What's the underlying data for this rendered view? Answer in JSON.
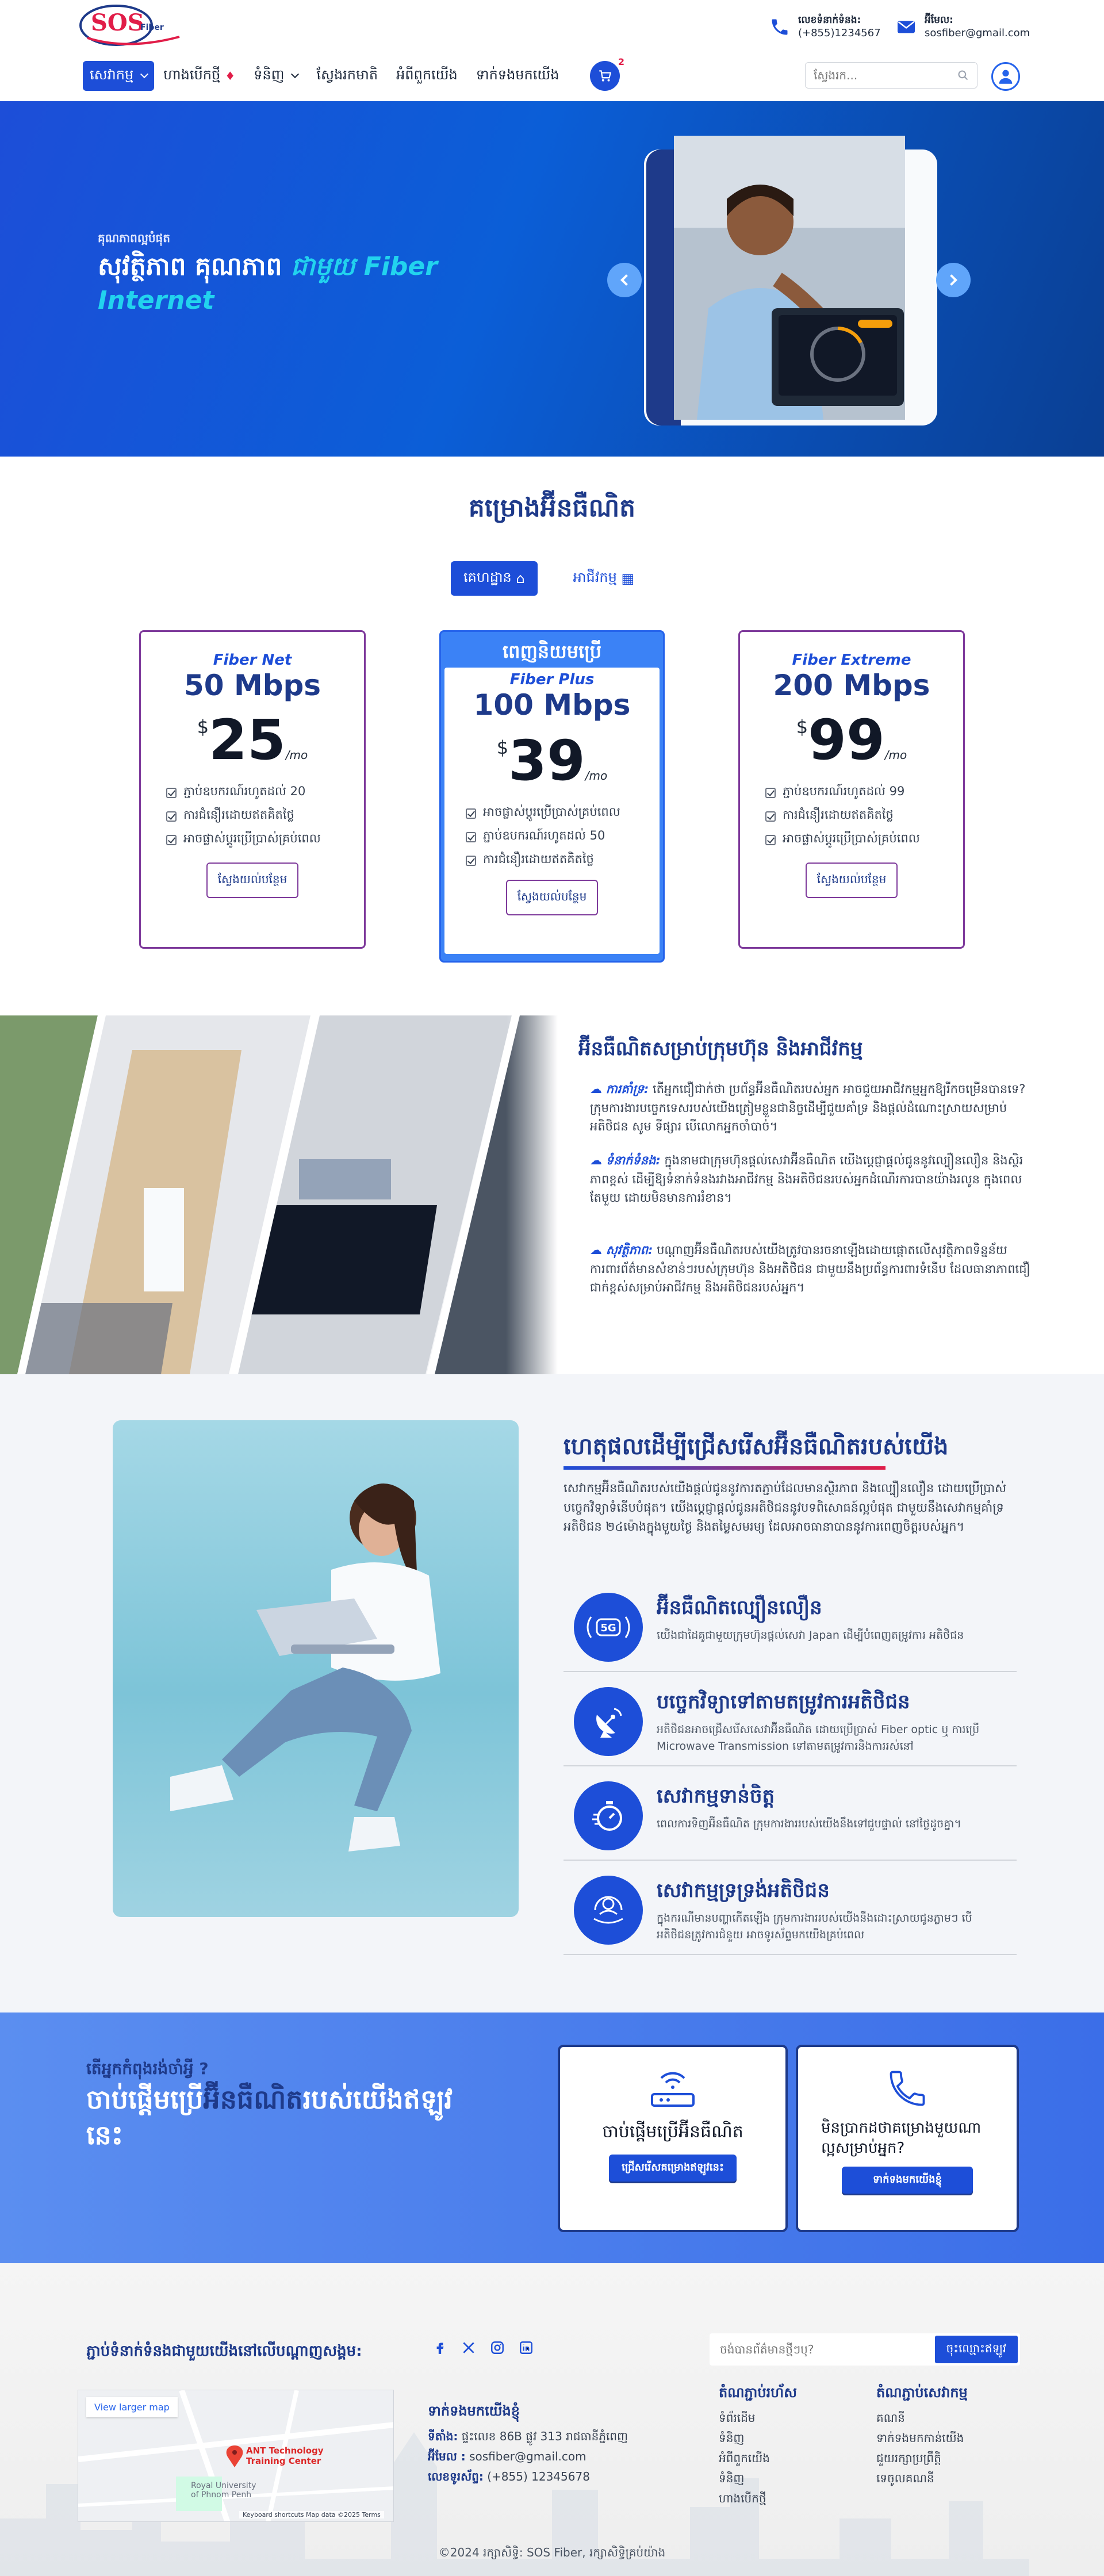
{
  "header": {
    "logo_text": "SOS",
    "logo_sub": "Fiber",
    "phone_label": "លេខទំនាក់ទំនង:",
    "phone": "(+855)1234567",
    "email_label": "អ៊ីមែល:",
    "email": "sosfiber@gmail.com",
    "nav": [
      {
        "label": "សេវាកម្ម"
      },
      {
        "label": "ហាងបើកថ្មី"
      },
      {
        "label": "ទំនិញ"
      },
      {
        "label": "ស្វែងរកមាតិ"
      },
      {
        "label": "អំពីពួកយើង"
      },
      {
        "label": "ទាក់ទងមកយើង"
      }
    ],
    "cart_count": "2",
    "search_placeholder": "ស្វែងរក..."
  },
  "hero": {
    "kicker": "គុណភាពល្អបំផុត",
    "title_a": "សុវត្ថិភាព គុណភាព ",
    "title_b": "ជាមួយ Fiber Internet"
  },
  "plans": {
    "title": "គម្រោងអ៊ីនធឺណិត",
    "tabs": [
      {
        "label": "គេហដ្ឋាន"
      },
      {
        "label": "អាជីវកម្ម"
      }
    ],
    "popular_label": "ពេញនិយមប្រើ",
    "cards": [
      {
        "name": "Fiber Net",
        "speed": "50 Mbps",
        "currency": "$",
        "price": "25",
        "per": "/mo",
        "features": [
          "ភ្ជាប់ឧបករណ៍រហូតដល់ 20",
          "ការជំនឿរដោយឥតគិតថ្លៃ",
          "អាចផ្លាស់ប្តូរប្រើប្រាស់គ្រប់ពេល"
        ],
        "button": "ស្វែងយល់បន្ថែម"
      },
      {
        "name": "Fiber Plus",
        "speed": "100 Mbps",
        "currency": "$",
        "price": "39",
        "per": "/mo",
        "features": [
          "អាចផ្លាស់ប្តូរប្រើប្រាស់គ្រប់ពេល",
          "ភ្ជាប់ឧបករណ៍រហូតដល់ 50",
          "ការជំនឿរដោយឥតគិតថ្លៃ"
        ],
        "button": "ស្វែងយល់បន្ថែម"
      },
      {
        "name": "Fiber Extreme",
        "speed": "200 Mbps",
        "currency": "$",
        "price": "99",
        "per": "/mo",
        "features": [
          "ភ្ជាប់ឧបករណ៍រហូតដល់ 99",
          "ការជំនឿរដោយឥតគិតថ្លៃ",
          "អាចផ្លាស់ប្តូរប្រើប្រាស់គ្រប់ពេល"
        ],
        "button": "ស្វែងយល់បន្ថែម"
      }
    ]
  },
  "business": {
    "title": "អ៊ីនធឺណិតសម្រាប់ក្រុមហ៊ុន និងអាជីវកម្ម",
    "items": [
      {
        "key": "ការគាំទ្រ:",
        "text": " តើអ្នកជឿជាក់ថា ប្រព័ន្ធអ៊ីនធឺណិតរបស់អ្នក អាចជួយអាជីវកម្មអ្នកឱ្យរីកចម្រើនបានទេ? ក្រុមការងារបច្ចេកទេសរបស់យើងត្រៀមខ្លួនជានិច្ចដើម្បីជួយគាំទ្រ និងផ្តល់ដំណោះស្រាយសម្រាប់អតិថិជន សូម ទីផ្សារ បើលោកអ្នកចាំបាច់។"
      },
      {
        "key": "ទំនាក់ទំនង:",
        "text": " ក្នុងនាមជាក្រុមហ៊ុនផ្តល់សេវាអ៊ីនធឺណិត យើងប្តេជ្ញាផ្តល់ជូននូវល្បឿនលឿន និងស្ថិរភាពខ្ពស់ ដើម្បីឱ្យទំនាក់ទំនងរវាងអាជីវកម្ម និងអតិថិជនរបស់អ្នកដំណើរការបានយ៉ាងរលូន ក្នុងពេលតែមួយ ដោយមិនមានការរំខាន។"
      },
      {
        "key": "សុវត្ថិភាព:",
        "text": " បណ្តាញអ៊ីនធឺណិតរបស់យើងត្រូវបានរចនាឡើងដោយផ្តោតលើសុវត្ថិភាពទិន្នន័យ ការពារព័ត៌មានសំខាន់ៗរបស់ក្រុមហ៊ុន និងអតិថិជន ជាមួយនឹងប្រព័ន្ធការពារទំនើប ដែលធានាភាពជឿជាក់ខ្ពស់សម្រាប់អាជីវកម្ម និងអតិថិជនរបស់អ្នក។"
      }
    ]
  },
  "why": {
    "title": "ហេតុផលដើម្បីជ្រើសរើសអ៊ីនធឺណិតរបស់យើង",
    "intro": "សេវាកម្មអ៊ីនធឺណិតរបស់យើងផ្តល់ជូននូវការតភ្ជាប់ដែលមានស្ថិរភាព និងល្បឿនលឿន ដោយប្រើប្រាស់បច្ចេកវិទ្យាទំនើបបំផុត។ យើងប្តេជ្ញាផ្តល់ជូនអតិថិជននូវបទពិសោធន៍ល្អបំផុត ជាមួយនឹងសេវាកម្មគាំទ្រអតិថិជន ២៤ម៉ោងក្នុងមួយថ្ងៃ និងតម្លៃសមរម្យ ដែលអាចធានាបាននូវការពេញចិត្តរបស់អ្នក។",
    "features": [
      {
        "title": "អ៊ីនធឺណិតល្បឿនលឿន",
        "desc": "យើងជាដៃគូជាមួយក្រុមហ៊ុនផ្តល់សេវា Japan ដើម្បីបំពេញតម្រូវការ អតិថិជន",
        "icon": "5g-icon"
      },
      {
        "title": "បច្ចេកវិទ្យាទៅតាមតម្រូវការអតិថិជន",
        "desc": "អតិថិជនអាចជ្រើសរើសសេវាអ៊ីនធឺណិត ដោយប្រើប្រាស់ Fiber optic ឬ ការប្រើ Microwave Transmission ទៅតាមតម្រូវការនិងការរស់នៅ",
        "icon": "satellite-icon"
      },
      {
        "title": "សេវាកម្មទាន់ចិត្ត",
        "desc": "ពេលការទិញអ៊ីនធឺណិត ក្រុមការងាររបស់យើងនឹងទៅជួបផ្ទាល់ នៅថ្ងៃដូចគ្នា។",
        "icon": "stopwatch-icon"
      },
      {
        "title": "សេវាកម្មទ្រទ្រង់អតិថិជន",
        "desc": "ក្នុងករណីមានបញ្ហាកើតឡើង ក្រុមការងាររបស់យើងនឹងដោះស្រាយជូនភ្លាមៗ បើអតិថិជនត្រូវការជំនួយ អាចទូរស័ព្ទមកយើងគ្រប់ពេល",
        "icon": "support-icon"
      }
    ]
  },
  "cta": {
    "question": "តើអ្នកកំពុងរង់ចាំអ្វី ?",
    "title_a": "ចាប់ផ្តើមប្រើ",
    "title_b": "អ៊ីនធឺណិត",
    "title_c": "របស់យើងឥឡូវនេះ",
    "box1_title": "ចាប់ផ្តើមប្រើអ៊ីនធឺណិត",
    "box1_button": "ជ្រើសរើសគម្រោងឥឡូវនេះ",
    "box2_title": "មិនប្រាកដថាគម្រោងមួយណាល្អសម្រាប់អ្នក?",
    "box2_button": "ទាក់ទងមកយើងខ្ញុំ"
  },
  "footer": {
    "connect": "ភ្ជាប់ទំនាក់ទំនងជាមួយយើងនៅលើបណ្តាញសង្គម:",
    "newsletter_placeholder": "ចង់បានព័ត៌មានថ្មីៗឬ?",
    "newsletter_button": "ចុះឈ្មោះឥឡូវ",
    "map_link": "View larger map",
    "map_place": "ANT Technology Training Center",
    "map_uni": "Royal University of Phnom Penh",
    "map_footer": "Keyboard shortcuts   Map data ©2025   Terms",
    "contact_head": "ទាក់ទងមកយើងខ្ញុំ",
    "address_label": "ទីតាំង:",
    "address": "ផ្ទះលេខ 86B ផ្លូវ 313 រាជធានីភ្នំពេញ",
    "email_label": "អ៊ីមែល :",
    "email": "sosfiber@gmail.com",
    "phone_label": "លេខទូរស័ព្ទ:",
    "phone": "(+855) 12345678",
    "col1_head": "តំណភ្ជាប់រហ័ស",
    "col1": [
      "ទំព័រដើម",
      "ទំនិញ",
      "អំពីពួកយើង",
      "ទំនិញ",
      "ហាងបើកថ្មី"
    ],
    "col2_head": "តំណភ្ជាប់សេវាកម្ម",
    "col2": [
      "គណនី",
      "ទាក់ទងមកកាន់យើង",
      "ជួយរក្សាប្រព្រឹត្តិ",
      "ទេចូលគណនី"
    ],
    "copyright": "©2024 រក្សាសិទ្ធិ: SOS Fiber, រក្សាសិទ្ធិគ្រប់យ៉ាង"
  },
  "colors": {
    "primary": "#1d4ed8",
    "navy": "#1e3a8a",
    "accent_cyan": "#22d3ee",
    "card_border": "#7e3a9b"
  }
}
